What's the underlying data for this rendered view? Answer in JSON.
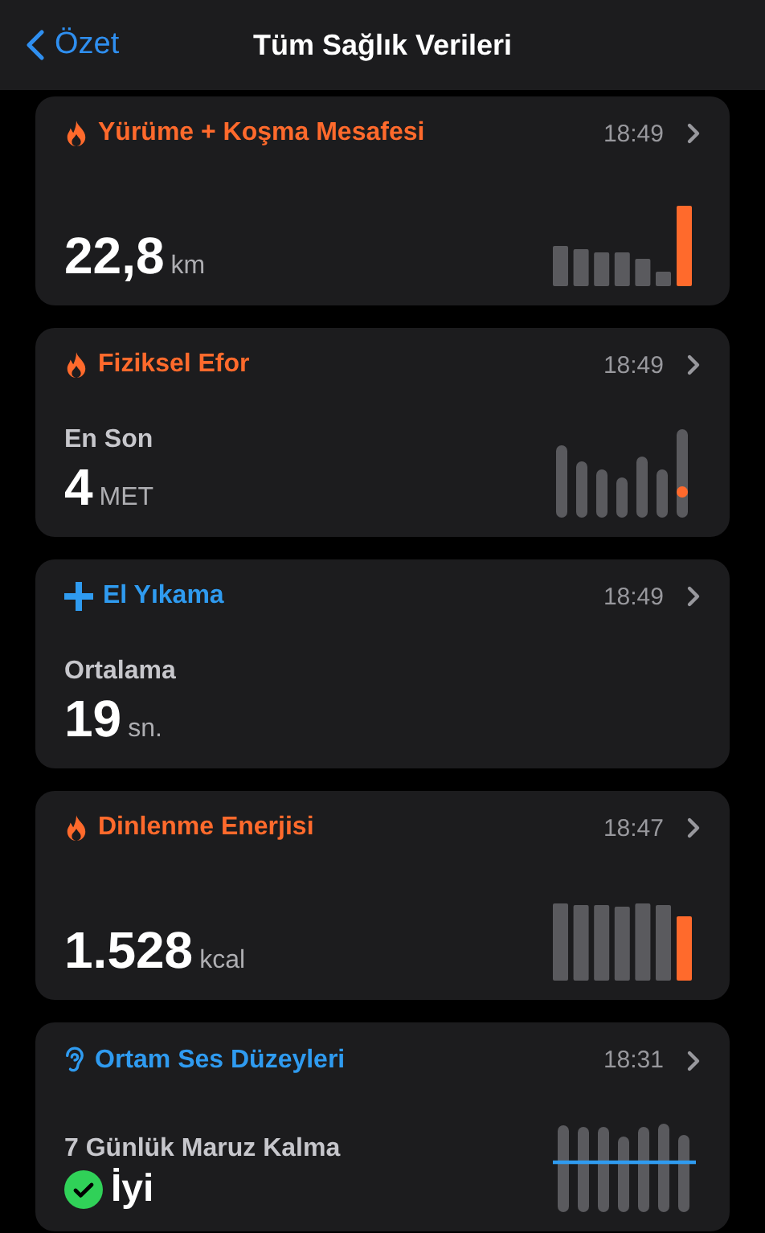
{
  "nav": {
    "back_label": "Özet",
    "title": "Tüm Sağlık Verileri"
  },
  "cards": [
    {
      "kind": "bars",
      "color": "#ff6a2c",
      "title": "Yürüme + Koşma Mesafesi",
      "time": "18:49",
      "value": "22,8",
      "unit": "km"
    },
    {
      "kind": "ranges",
      "color": "#ff6a2c",
      "title": "Fiziksel Efor",
      "time": "18:49",
      "label": "En Son",
      "value": "4",
      "unit": "MET"
    },
    {
      "kind": "plain",
      "color": "#2f9bf0",
      "title": "El Yıkama",
      "time": "18:49",
      "label": "Ortalama",
      "value": "19",
      "unit": "sn."
    },
    {
      "kind": "full-bars",
      "color": "#ff6a2c",
      "title": "Dinlenme Enerjisi",
      "time": "18:47",
      "value": "1.528",
      "unit": "kcal"
    },
    {
      "kind": "level-line",
      "color": "#2f9bf0",
      "title": "Ortam Ses Düzeyleri",
      "time": "18:31",
      "label": "7 Günlük Maruz Kalma",
      "status": "İyi",
      "status_ok": true
    }
  ]
}
